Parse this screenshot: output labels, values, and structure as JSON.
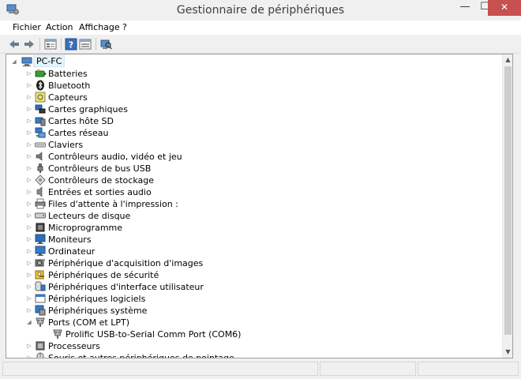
{
  "window": {
    "title": "Gestionnaire de périphériques",
    "min_glyph": "—",
    "max_glyph": "☐",
    "close_glyph": "✕"
  },
  "menu": {
    "file": "Fichier",
    "action": "Action",
    "view": "Affichage",
    "help": "?"
  },
  "toolbar": {
    "icons": [
      "back-arrow-icon",
      "forward-arrow-icon",
      "properties-icon",
      "help-icon",
      "view-icon",
      "scan-hardware-icon"
    ]
  },
  "tree": {
    "root": "PC-FC",
    "items": [
      {
        "label": "Batteries",
        "icon": "battery-icon",
        "state": "collapsed"
      },
      {
        "label": "Bluetooth",
        "icon": "bluetooth-icon",
        "state": "collapsed"
      },
      {
        "label": "Capteurs",
        "icon": "sensor-icon",
        "state": "collapsed"
      },
      {
        "label": "Cartes graphiques",
        "icon": "display-adapter-icon",
        "state": "collapsed"
      },
      {
        "label": "Cartes hôte SD",
        "icon": "sd-host-icon",
        "state": "collapsed"
      },
      {
        "label": "Cartes réseau",
        "icon": "network-adapter-icon",
        "state": "collapsed"
      },
      {
        "label": "Claviers",
        "icon": "keyboard-icon",
        "state": "collapsed"
      },
      {
        "label": "Contrôleurs audio, vidéo et jeu",
        "icon": "audio-icon",
        "state": "collapsed"
      },
      {
        "label": "Contrôleurs de bus USB",
        "icon": "usb-icon",
        "state": "collapsed"
      },
      {
        "label": "Contrôleurs de stockage",
        "icon": "storage-controller-icon",
        "state": "collapsed"
      },
      {
        "label": "Entrées et sorties audio",
        "icon": "audio-io-icon",
        "state": "collapsed"
      },
      {
        "label": "Files d'attente à l'impression :",
        "icon": "printer-icon",
        "state": "collapsed"
      },
      {
        "label": "Lecteurs de disque",
        "icon": "disk-drive-icon",
        "state": "collapsed"
      },
      {
        "label": "Microprogramme",
        "icon": "firmware-icon",
        "state": "collapsed"
      },
      {
        "label": "Moniteurs",
        "icon": "monitor-icon",
        "state": "collapsed"
      },
      {
        "label": "Ordinateur",
        "icon": "computer-icon",
        "state": "collapsed"
      },
      {
        "label": "Périphérique d'acquisition d'images",
        "icon": "imaging-device-icon",
        "state": "collapsed"
      },
      {
        "label": "Périphériques de sécurité",
        "icon": "security-device-icon",
        "state": "collapsed"
      },
      {
        "label": "Périphériques d'interface utilisateur",
        "icon": "hid-icon",
        "state": "collapsed"
      },
      {
        "label": "Périphériques logiciels",
        "icon": "software-device-icon",
        "state": "collapsed"
      },
      {
        "label": "Périphériques système",
        "icon": "system-device-icon",
        "state": "collapsed"
      },
      {
        "label": "Ports (COM et LPT)",
        "icon": "port-icon",
        "state": "expanded"
      },
      {
        "label": "Prolific USB-to-Serial Comm Port (COM6)",
        "icon": "port-icon",
        "state": "child"
      },
      {
        "label": "Processeurs",
        "icon": "processor-icon",
        "state": "collapsed"
      },
      {
        "label": "Souris et autres périphériques de pointage",
        "icon": "mouse-icon",
        "state": "collapsed"
      }
    ]
  },
  "colors": {
    "selection": "#e5f3fb",
    "close_button": "#c75050",
    "window_bg": "#f0f0f0"
  }
}
